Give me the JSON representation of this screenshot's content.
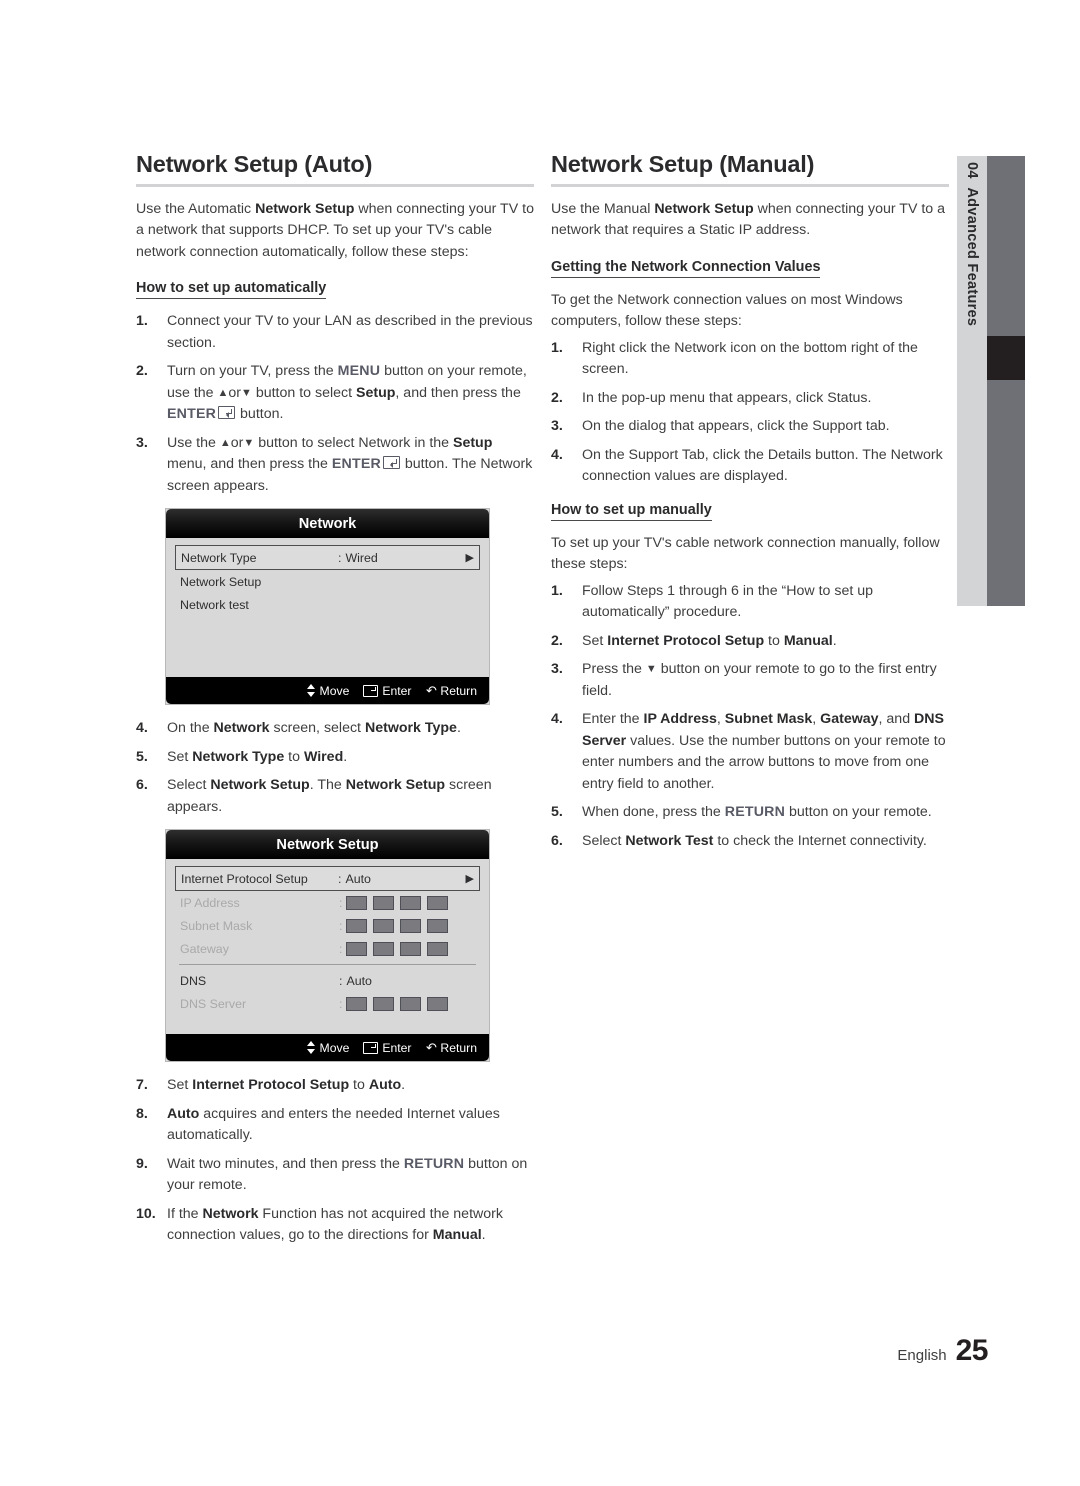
{
  "page": {
    "language_label": "English",
    "page_number": "25"
  },
  "side_tab": {
    "chapter_number": "04",
    "chapter_title": "Advanced Features"
  },
  "left_column": {
    "title": "Network Setup (Auto)",
    "intro": "Use the Automatic Network Setup when connecting your TV to a network that supports DHCP. To set up your TV's cable network connection automatically, follow these steps:",
    "intro_parts": {
      "a": "Use the Automatic ",
      "b": "Network Setup",
      "c": " when connecting your TV to a network that supports DHCP. To set up your TV's cable network connection automatically, follow these steps:"
    },
    "subheading": "How to set up automatically",
    "steps": [
      {
        "num": "1.",
        "text": "Connect your TV to your LAN as described in the previous section."
      },
      {
        "num": "2.",
        "text": "Turn on your TV, press the MENU button on your remote, use the ▲or▼ button to select Setup, and then press the ENTER button.",
        "parts": {
          "p1": "Turn on your TV, press the ",
          "menu": "MENU",
          "p2": " button on your remote, use the ",
          "up": "▲",
          "or": "or",
          "down": "▼",
          "p3": " button to select ",
          "setup": "Setup",
          "p4": ", and then press the ",
          "enter": "ENTER",
          "p5": " button."
        }
      },
      {
        "num": "3.",
        "text": "Use the ▲or▼ button to select Network in the Setup menu, and then press the ENTER button. The Network screen appears.",
        "parts": {
          "p1": "Use the ",
          "up": "▲",
          "or": "or",
          "down": "▼",
          "p2": " button to select Network in the ",
          "setup": "Setup",
          "p3": " menu, and then press the ",
          "enter": "ENTER",
          "p4": " button. The Network screen appears."
        }
      },
      {
        "num": "4.",
        "text": "On the Network screen, select Network Type.",
        "parts": {
          "p1": "On the ",
          "b1": "Network",
          "p2": " screen, select ",
          "b2": "Network Type",
          "p3": "."
        }
      },
      {
        "num": "5.",
        "text": "Set Network Type to Wired.",
        "parts": {
          "p1": "Set ",
          "b1": "Network Type",
          "p2": " to ",
          "b2": "Wired",
          "p3": "."
        }
      },
      {
        "num": "6.",
        "text": "Select Network Setup. The Network Setup screen appears.",
        "parts": {
          "p1": "Select ",
          "b1": "Network Setup",
          "p2": ". The ",
          "b2": "Network Setup",
          "p3": " screen appears."
        }
      },
      {
        "num": "7.",
        "text": "Set Internet Protocol Setup to Auto.",
        "parts": {
          "p1": "Set ",
          "b1": "Internet Protocol Setup",
          "p2": " to ",
          "b2": "Auto",
          "p3": "."
        }
      },
      {
        "num": "8.",
        "text": "Auto acquires and enters the needed Internet values automatically.",
        "parts": {
          "b1": "Auto",
          "p1": " acquires and enters the needed Internet values automatically."
        }
      },
      {
        "num": "9.",
        "text": "Wait two minutes, and then press the RETURN button on your remote.",
        "parts": {
          "p1": "Wait two minutes, and then press the ",
          "kb": "RETURN",
          "p2": " button on your remote."
        }
      },
      {
        "num": "10.",
        "text": "If the Network Function has not acquired the network connection values, go to the directions for Manual.",
        "parts": {
          "p1": "If the ",
          "b1": "Network",
          "p2": " Function has not acquired the network connection values, go to the directions for ",
          "b2": "Manual",
          "p3": "."
        }
      }
    ]
  },
  "right_column": {
    "title": "Network Setup (Manual)",
    "intro_parts": {
      "a": "Use the Manual ",
      "b": "Network Setup",
      "c": " when connecting your TV to a network that requires a Static IP address."
    },
    "subheading_1": "Getting the Network Connection Values",
    "lead_1": "To get the Network connection values on most Windows computers, follow these steps:",
    "steps_1": [
      {
        "num": "1.",
        "text": "Right click the Network icon on the bottom right of the screen."
      },
      {
        "num": "2.",
        "text": "In the pop-up menu that appears, click Status."
      },
      {
        "num": "3.",
        "text": "On the dialog that appears, click the Support tab."
      },
      {
        "num": "4.",
        "text": "On the Support Tab, click the Details button. The Network connection values are displayed."
      }
    ],
    "subheading_2": "How to set up manually",
    "lead_2": "To set up your TV's cable network connection manually, follow these steps:",
    "steps_2": [
      {
        "num": "1.",
        "text": "Follow Steps 1 through 6 in the “How to set up automatically” procedure."
      },
      {
        "num": "2.",
        "text": "Set Internet Protocol Setup to Manual.",
        "parts": {
          "p1": "Set ",
          "b1": "Internet Protocol Setup",
          "p2": " to ",
          "b2": "Manual",
          "p3": "."
        }
      },
      {
        "num": "3.",
        "text": "Press the ▼ button on your remote to go to the first entry field.",
        "parts": {
          "p1": "Press the ",
          "down": "▼",
          "p2": " button on your remote to go to the first entry field."
        }
      },
      {
        "num": "4.",
        "text": "Enter the IP Address, Subnet Mask, Gateway, and DNS Server values. Use the number buttons on your remote to enter numbers and the arrow buttons to move from one entry field to another.",
        "parts": {
          "p1": "Enter the ",
          "b1": "IP Address",
          "p2": ", ",
          "b2": "Subnet Mask",
          "p3": ", ",
          "b3": "Gateway",
          "p4": ", and ",
          "b4": "DNS Server",
          "p5": " values. Use the number buttons on your remote to enter numbers and the arrow buttons to move from one entry field to another."
        }
      },
      {
        "num": "5.",
        "text": "When done, press the RETURN button on your remote.",
        "parts": {
          "p1": "When done, press the ",
          "kb": "RETURN",
          "p2": " button on your remote."
        }
      },
      {
        "num": "6.",
        "text": "Select Network Test to check the Internet connectivity.",
        "parts": {
          "p1": "Select ",
          "b1": "Network Test",
          "p2": " to check the Internet connectivity."
        }
      }
    ]
  },
  "osd_network": {
    "title": "Network",
    "rows": [
      {
        "label": "Network Type",
        "value": "Wired",
        "selected": true,
        "caret": "▶"
      },
      {
        "label": "Network Setup",
        "value": ""
      },
      {
        "label": "Network test",
        "value": ""
      }
    ],
    "footer": {
      "move": "Move",
      "enter": "Enter",
      "return": "Return"
    }
  },
  "osd_network_setup": {
    "title": "Network Setup",
    "rows": [
      {
        "label": "Internet Protocol Setup",
        "value": "Auto",
        "selected": true,
        "caret": "▶"
      },
      {
        "label": "IP Address",
        "dim": true,
        "boxes": 4
      },
      {
        "label": "Subnet Mask",
        "dim": true,
        "boxes": 4
      },
      {
        "label": "Gateway",
        "dim": true,
        "boxes": 4
      },
      {
        "label": "DNS",
        "value": "Auto"
      },
      {
        "label": "DNS Server",
        "dim": true,
        "boxes": 4
      }
    ],
    "footer": {
      "move": "Move",
      "enter": "Enter",
      "return": "Return"
    }
  }
}
